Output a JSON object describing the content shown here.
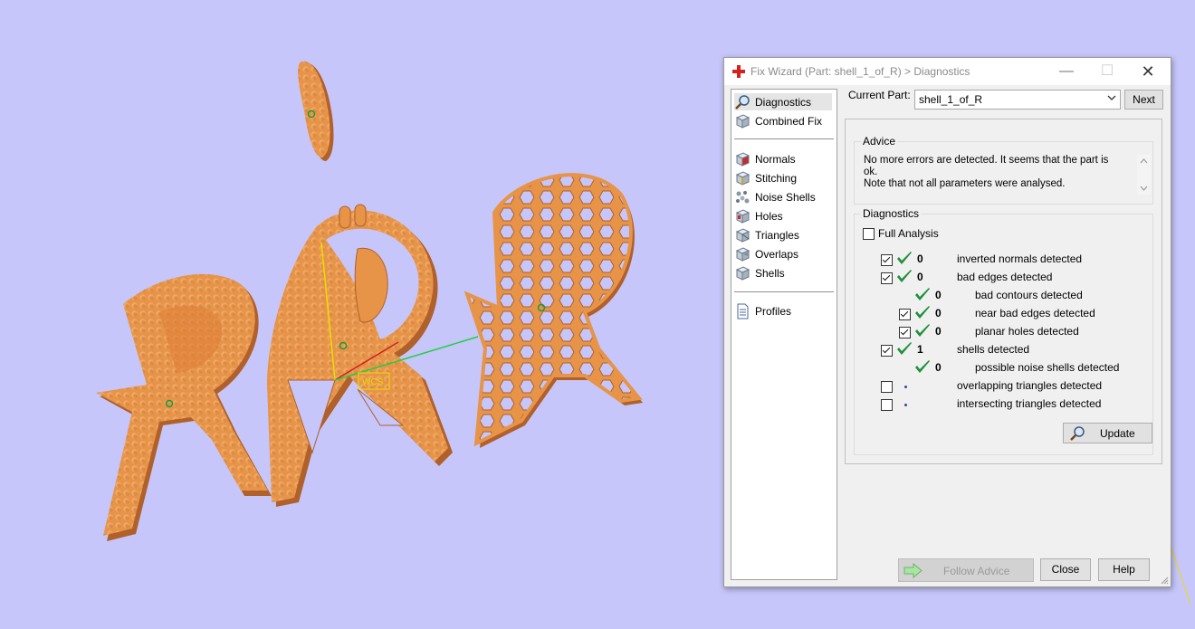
{
  "dialog": {
    "title": "Fix Wizard (Part: shell_1_of_R) > Diagnostics",
    "minimize_glyph": "—",
    "maximize_glyph": "☐",
    "close_glyph": "✕"
  },
  "nav": {
    "top_items": [
      {
        "label": "Diagnostics",
        "icon": "magnifier-icon",
        "selected": true
      },
      {
        "label": "Combined Fix",
        "icon": "cube-icon",
        "selected": false
      }
    ],
    "fix_items": [
      {
        "label": "Normals",
        "icon": "normals-cube-icon"
      },
      {
        "label": "Stitching",
        "icon": "stitching-cube-icon"
      },
      {
        "label": "Noise Shells",
        "icon": "noise-shells-icon"
      },
      {
        "label": "Holes",
        "icon": "holes-cube-icon"
      },
      {
        "label": "Triangles",
        "icon": "triangles-cube-icon"
      },
      {
        "label": "Overlaps",
        "icon": "overlaps-cube-icon"
      },
      {
        "label": "Shells",
        "icon": "shells-cube-icon"
      }
    ],
    "profiles": {
      "label": "Profiles",
      "icon": "document-icon"
    }
  },
  "current_part": {
    "label": "Current Part:",
    "value": "shell_1_of_R",
    "next_label": "Next"
  },
  "advice": {
    "title": "Advice",
    "line1": "No more errors are detected. It seems that the part is ok.",
    "line2": "Note that not all parameters were analysed."
  },
  "diagnostics": {
    "title": "Diagnostics",
    "full_analysis": {
      "label": "Full Analysis",
      "checked": false
    },
    "rows": [
      {
        "checkbox": true,
        "checked": true,
        "status": "ok",
        "count": "0",
        "label": "inverted normals detected",
        "indent": 0
      },
      {
        "checkbox": true,
        "checked": true,
        "status": "ok",
        "count": "0",
        "label": "bad edges detected",
        "indent": 0
      },
      {
        "checkbox": false,
        "checked": false,
        "status": "ok",
        "count": "0",
        "label": "bad contours detected",
        "indent": 1
      },
      {
        "checkbox": true,
        "checked": true,
        "status": "ok",
        "count": "0",
        "label": "near bad edges detected",
        "indent": 1
      },
      {
        "checkbox": true,
        "checked": true,
        "status": "ok",
        "count": "0",
        "label": "planar holes detected",
        "indent": 1
      },
      {
        "checkbox": true,
        "checked": true,
        "status": "ok",
        "count": "1",
        "label": "shells detected",
        "indent": 0
      },
      {
        "checkbox": false,
        "checked": false,
        "status": "ok",
        "count": "0",
        "label": "possible noise shells detected",
        "indent": 1
      },
      {
        "checkbox": true,
        "checked": false,
        "status": "pending",
        "count": "",
        "label": "overlapping triangles detected",
        "indent": 0
      },
      {
        "checkbox": true,
        "checked": false,
        "status": "pending",
        "count": "",
        "label": "intersecting triangles detected",
        "indent": 0
      }
    ],
    "update_label": "Update"
  },
  "footer": {
    "follow_advice_label": "Follow Advice",
    "close_label": "Close",
    "help_label": "Help"
  },
  "colors": {
    "viewport_bg": "#c6c6fb",
    "model_fill": "#e79448",
    "model_shade": "#b0602a",
    "tick_green": "#1f8f3a"
  }
}
